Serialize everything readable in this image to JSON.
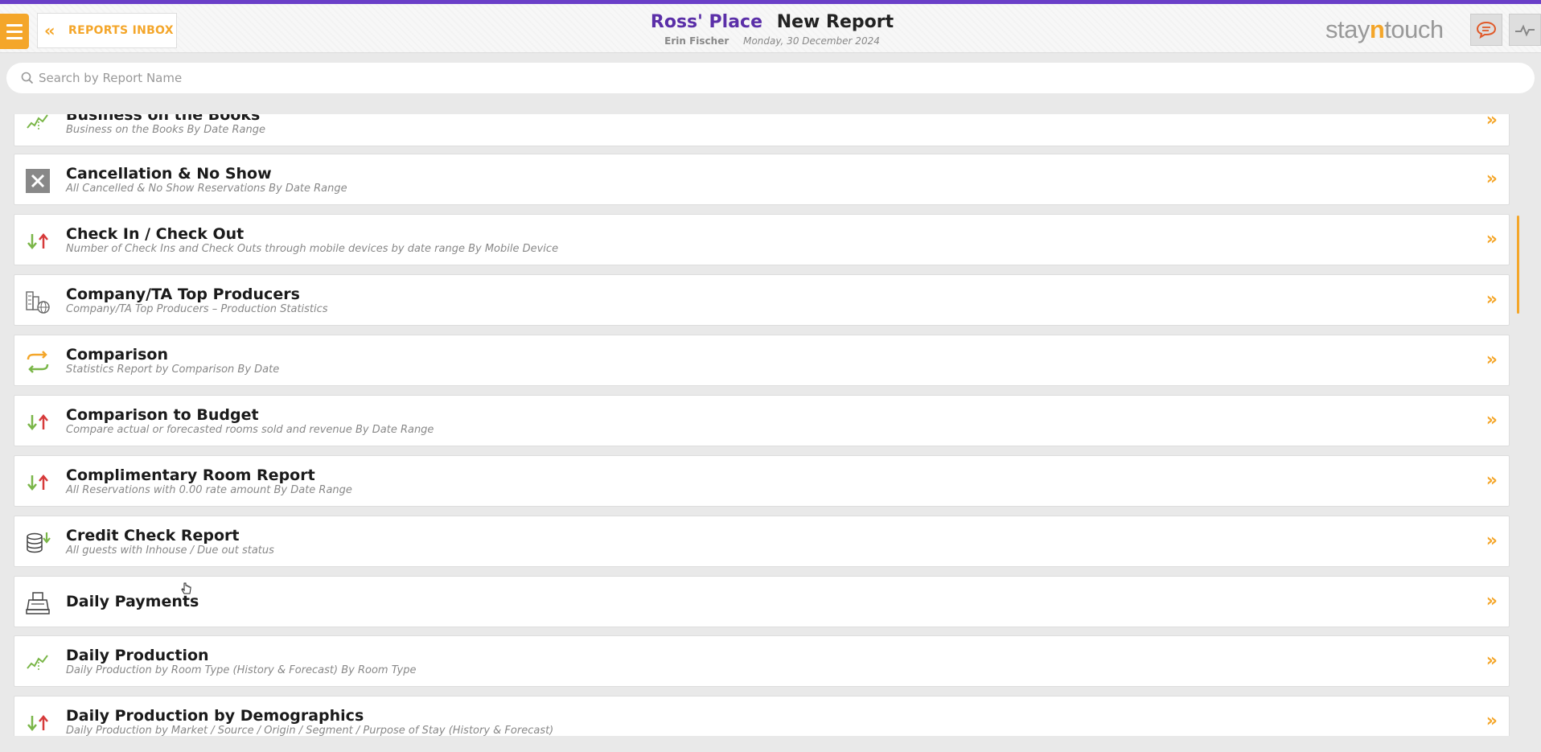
{
  "header": {
    "inbox_label": "REPORTS INBOX",
    "hotel_name": "Ross' Place",
    "title": "New Report",
    "user": "Erin Fischer",
    "date": "Monday, 30 December 2024",
    "logo_left": "stay",
    "logo_n": "n",
    "logo_right": "touch"
  },
  "search": {
    "placeholder": "Search by Report Name",
    "value": ""
  },
  "colors": {
    "accent": "#f4a62a",
    "brand": "#5b2fa8",
    "topbar": "#6a3fc8"
  },
  "reports": [
    {
      "name": "Business on the Books",
      "desc": "Business on the Books By Date Range",
      "icon": "line-chart-icon"
    },
    {
      "name": "Cancellation & No Show",
      "desc": "All Cancelled & No Show Reservations By Date Range",
      "icon": "close-box-icon"
    },
    {
      "name": "Check In / Check Out",
      "desc": "Number of Check Ins and Check Outs through mobile devices by date range By Mobile Device",
      "icon": "arrows-up-down-icon"
    },
    {
      "name": "Company/TA Top Producers",
      "desc": "Company/TA Top Producers – Production Statistics",
      "icon": "building-globe-icon"
    },
    {
      "name": "Comparison",
      "desc": "Statistics Report by Comparison By Date",
      "icon": "swap-arrows-icon"
    },
    {
      "name": "Comparison to Budget",
      "desc": "Compare actual or forecasted rooms sold and revenue By Date Range",
      "icon": "arrows-up-down-icon"
    },
    {
      "name": "Complimentary Room Report",
      "desc": "All Reservations with 0.00 rate amount By Date Range",
      "icon": "arrows-up-down-icon"
    },
    {
      "name": "Credit Check Report",
      "desc": "All guests with Inhouse / Due out status",
      "icon": "coins-icon"
    },
    {
      "name": "Daily Payments",
      "desc": "",
      "icon": "cash-register-icon"
    },
    {
      "name": "Daily Production",
      "desc": "Daily Production by Room Type (History & Forecast) By Room Type",
      "icon": "line-chart-icon"
    },
    {
      "name": "Daily Production by Demographics",
      "desc": "Daily Production by Market / Source / Origin / Segment / Purpose of Stay (History & Forecast)",
      "icon": "arrows-up-down-icon"
    }
  ]
}
